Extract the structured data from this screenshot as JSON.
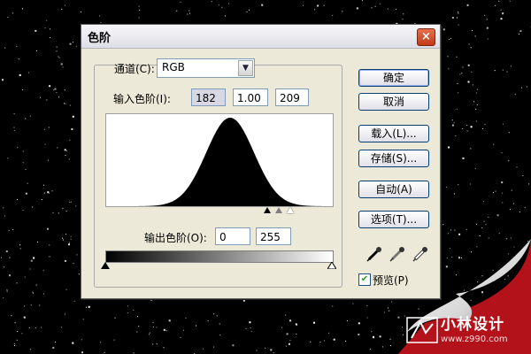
{
  "dialog": {
    "title": "色阶",
    "close_glyph": "×",
    "channel_label": "通道(C):",
    "channel_value": "RGB",
    "input_levels_label": "输入色阶(I):",
    "input_levels": [
      "182",
      "1.00",
      "209"
    ],
    "output_levels_label": "输出色阶(O):",
    "output_levels": [
      "0",
      "255"
    ],
    "preview_label": "预览(P)",
    "preview_checked": true
  },
  "buttons": {
    "ok": "确定",
    "cancel": "取消",
    "load": "载入(L)...",
    "save": "存储(S)...",
    "auto": "自动(A)",
    "options": "选项(T)..."
  },
  "icons": [
    "close-icon",
    "dropdown-arrow-icon",
    "black-eyedropper-icon",
    "gray-eyedropper-icon",
    "white-eyedropper-icon",
    "checkmark-icon"
  ],
  "histogram": {
    "shape": "bell",
    "peak_level": 140,
    "spread": 27,
    "color": "#000000"
  },
  "branding": {
    "name": "小林设计",
    "url": "www.z990.com",
    "accent": "#b4121a"
  }
}
